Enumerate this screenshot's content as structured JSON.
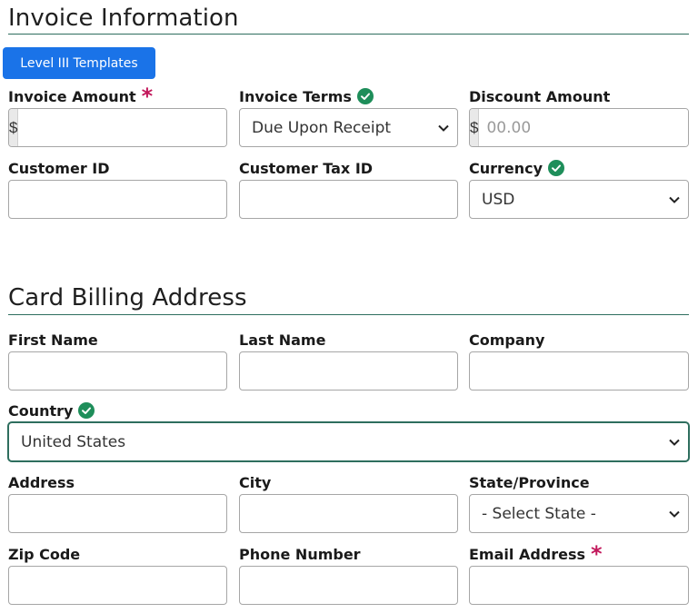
{
  "invoice_section": {
    "title": "Invoice Information",
    "templates_button": "Level III Templates",
    "invoice_amount": {
      "label": "Invoice Amount",
      "prefix": "$",
      "value": ""
    },
    "invoice_terms": {
      "label": "Invoice Terms",
      "selected": "Due Upon Receipt"
    },
    "discount_amount": {
      "label": "Discount Amount",
      "prefix": "$",
      "placeholder": "00.00"
    },
    "customer_id": {
      "label": "Customer ID",
      "value": ""
    },
    "customer_tax_id": {
      "label": "Customer Tax ID",
      "value": ""
    },
    "currency": {
      "label": "Currency",
      "selected": "USD"
    }
  },
  "billing_section": {
    "title": "Card Billing Address",
    "first_name": {
      "label": "First Name",
      "value": ""
    },
    "last_name": {
      "label": "Last Name",
      "value": ""
    },
    "company": {
      "label": "Company",
      "value": ""
    },
    "country": {
      "label": "Country",
      "selected": "United States"
    },
    "address": {
      "label": "Address",
      "value": ""
    },
    "city": {
      "label": "City",
      "value": ""
    },
    "state": {
      "label": "State/Province",
      "selected": "- Select State -"
    },
    "zip": {
      "label": "Zip Code",
      "value": ""
    },
    "phone": {
      "label": "Phone Number",
      "value": ""
    },
    "email": {
      "label": "Email Address",
      "value": ""
    }
  },
  "icons": {
    "required": "asterisk-icon",
    "valid": "check-circle-icon",
    "dropdown": "chevron-down-icon"
  },
  "colors": {
    "primary_button": "#1a73e8",
    "required": "#c2185b",
    "valid": "#1e8e5a",
    "section_rule": "#2e6e5e"
  }
}
